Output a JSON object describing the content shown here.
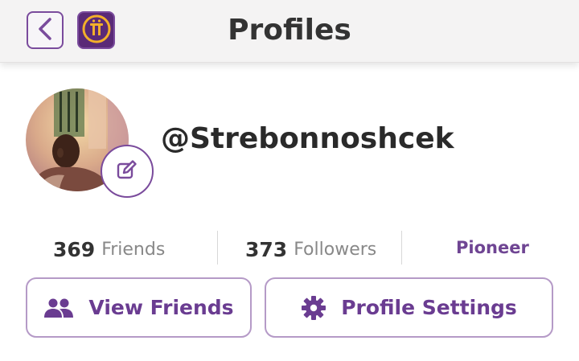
{
  "header": {
    "title": "Profiles",
    "back_icon": "chevron-left-icon",
    "app_icon": "pi-network-logo-icon"
  },
  "profile": {
    "username": "@Strebonnoshcek",
    "edit_icon": "pencil-icon"
  },
  "stats": {
    "friends_count": "369",
    "friends_label": "Friends",
    "followers_count": "373",
    "followers_label": "Followers",
    "role": "Pioneer"
  },
  "actions": {
    "view_friends_label": "View Friends",
    "view_friends_icon": "people-icon",
    "profile_settings_label": "Profile Settings",
    "profile_settings_icon": "gear-icon"
  },
  "colors": {
    "accent": "#6a3c91",
    "accent_light": "#b59ac7",
    "header_bg": "#f4f3f3",
    "app_icon_bg": "#5a2a77",
    "app_icon_gold": "#f3b02a"
  }
}
